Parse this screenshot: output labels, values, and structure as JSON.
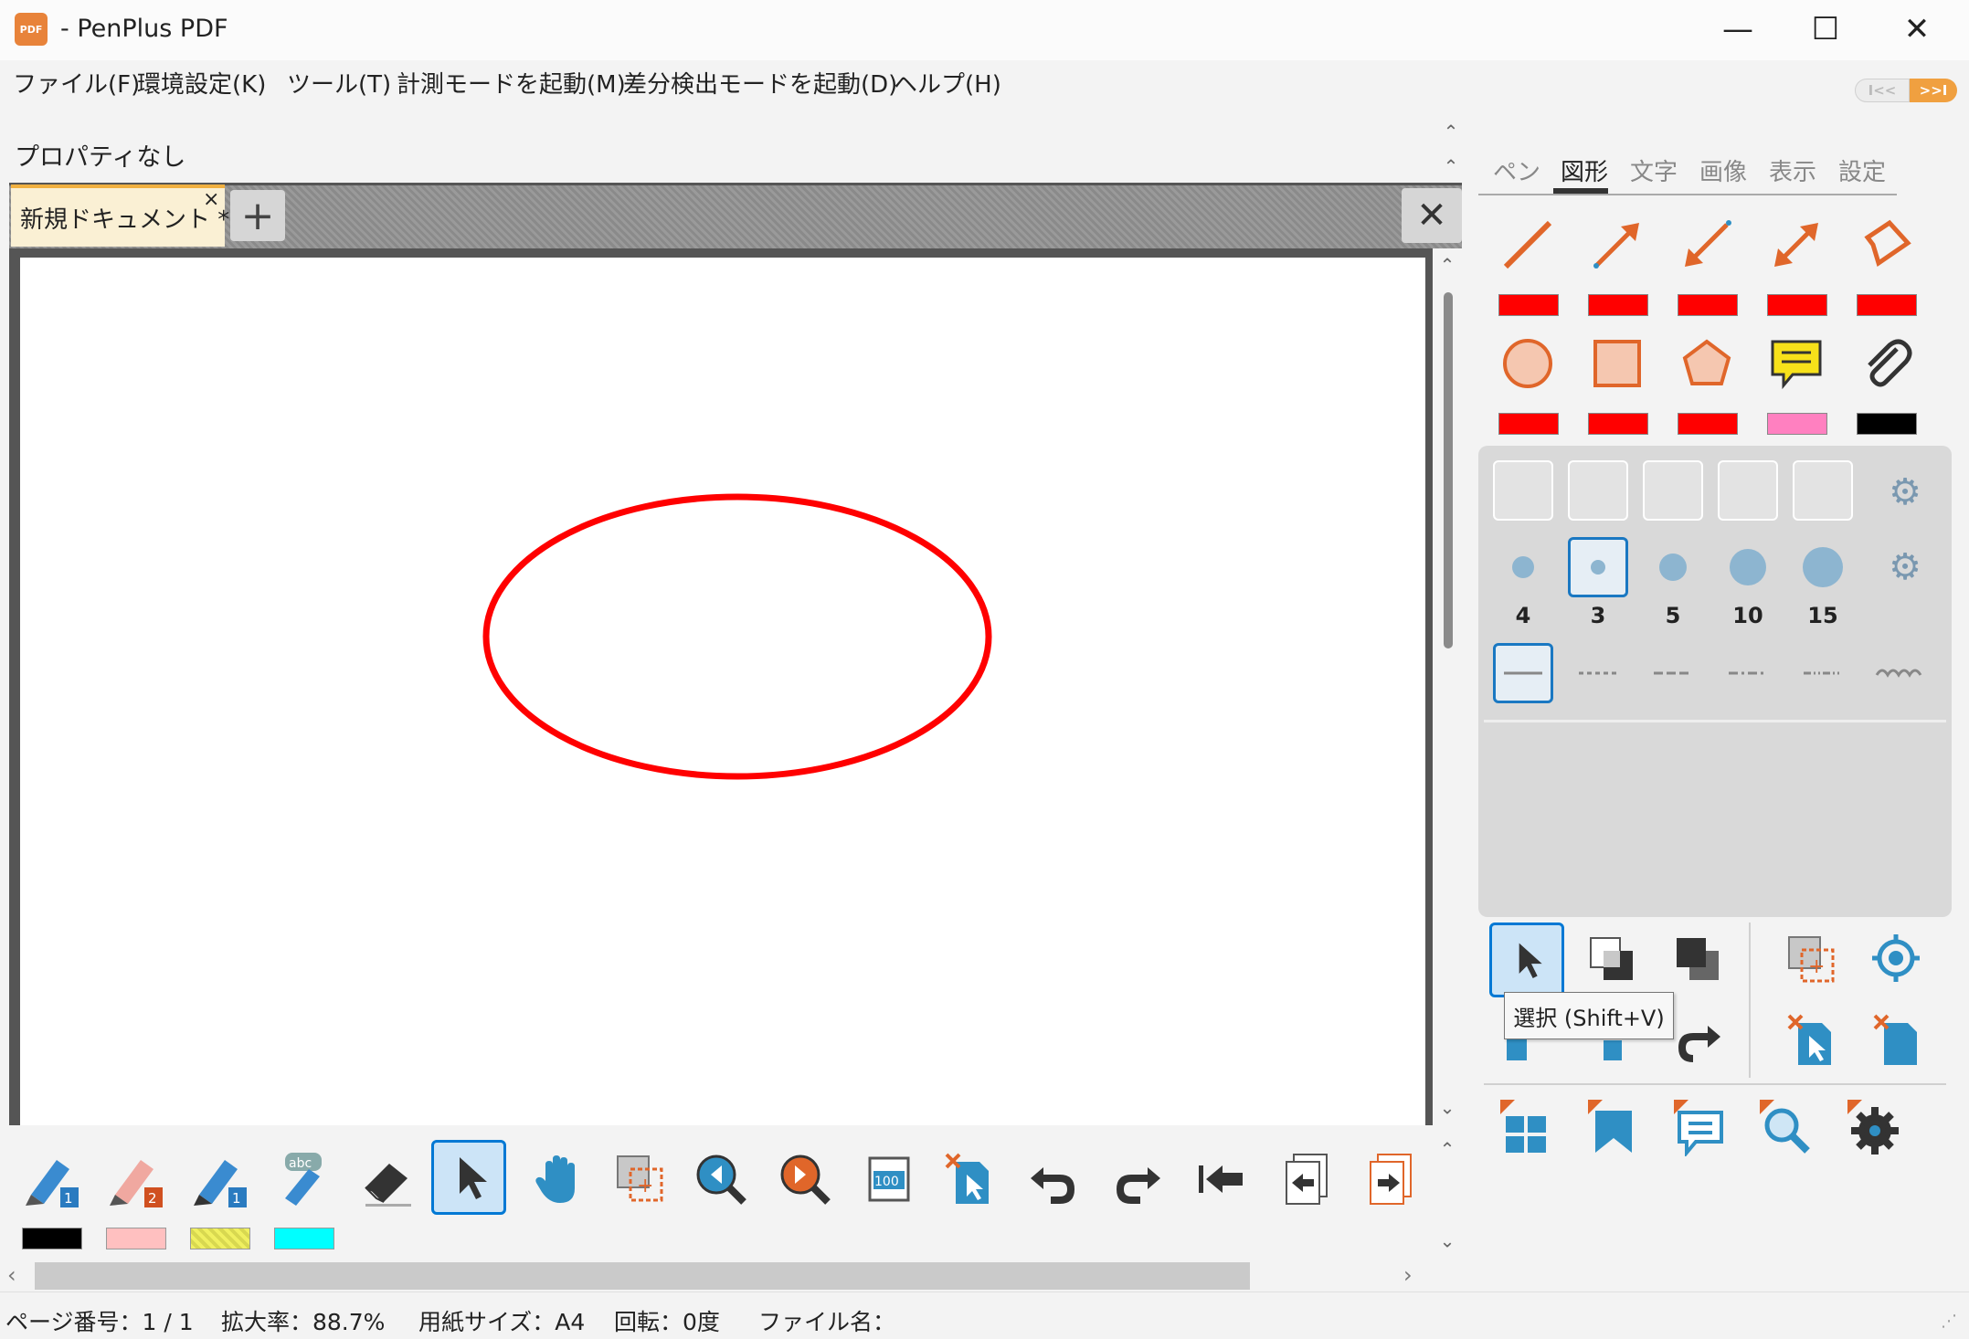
{
  "window": {
    "title": "- PenPlus PDF",
    "icon_text": "PDF"
  },
  "window_controls": {
    "minimize": "—",
    "maximize": "☐",
    "close": "✕"
  },
  "menu": [
    {
      "label": "ファイル(F)"
    },
    {
      "label": "環境設定(K)"
    },
    {
      "label": "ツール(T)"
    },
    {
      "label": "計測モードを起動(M)"
    },
    {
      "label": "差分検出モードを起動(D)"
    },
    {
      "label": "ヘルプ(H)"
    }
  ],
  "nav": {
    "prev": "I<<",
    "next": ">>I"
  },
  "property_bar": {
    "text": "プロパティなし"
  },
  "document_tab": {
    "label": "新規ドキュメント *",
    "close": "×",
    "add": "+",
    "close_all": "✕"
  },
  "drawing": {
    "shape": "ellipse",
    "stroke_color": "#ff0000"
  },
  "bottom_swatches": [
    "#000000",
    "#ffc0c0",
    "#f0f060",
    "#00ffff"
  ],
  "status": {
    "page": "ページ番号：1 / 1",
    "zoom": "拡大率：88.7%",
    "paper": "用紙サイズ：A4",
    "rotation": "回転：0度",
    "filename": "ファイル名："
  },
  "panel": {
    "tabs": [
      {
        "label": "ペン",
        "active": false
      },
      {
        "label": "図形",
        "active": true
      },
      {
        "label": "文字",
        "active": false
      },
      {
        "label": "画像",
        "active": false
      },
      {
        "label": "表示",
        "active": false
      },
      {
        "label": "設定",
        "active": false
      }
    ],
    "shape_row1_colors": [
      "#ff0000",
      "#ff0000",
      "#ff0000",
      "#ff0000",
      "#ff0000"
    ],
    "shape_row2_colors": [
      "#ff0000",
      "#ff0000",
      "#ff0000",
      "#ff80c0",
      "#000000"
    ],
    "line_widths": [
      "4",
      "3",
      "5",
      "10",
      "15"
    ],
    "selected_width": "3"
  },
  "tooltip": {
    "text": "選択 (Shift+V)"
  },
  "colors": {
    "accent": "#0078d4",
    "shape_orange": "#e0662a",
    "icon_blue": "#2f8fc4"
  }
}
